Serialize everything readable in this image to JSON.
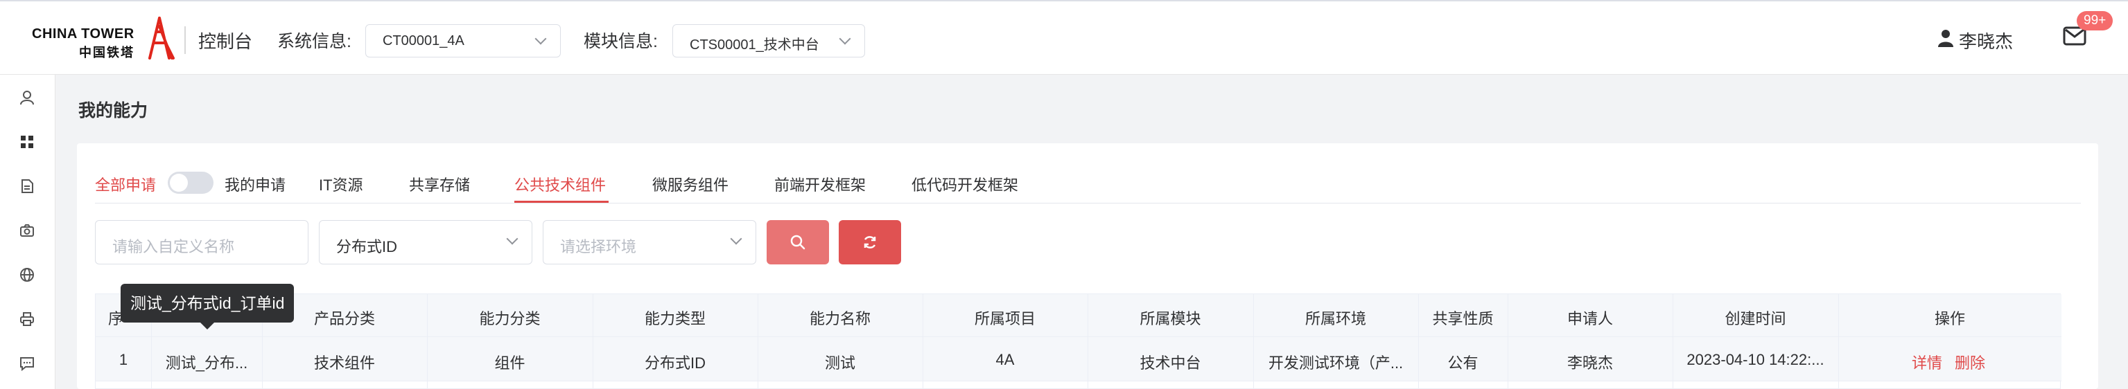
{
  "header": {
    "logo_en": "CHINA TOWER",
    "logo_cn": "中国铁塔",
    "console": "控制台",
    "system_label": "系统信息:",
    "system_value": "CT00001_4A",
    "module_label": "模块信息:",
    "module_value": "CTS00001_技术中台",
    "user_name": "李晓杰",
    "mail_badge": "99+"
  },
  "sidebar": {
    "items": [
      "user-icon",
      "grid-icon",
      "document-icon",
      "camera-icon",
      "globe-icon",
      "printer-icon",
      "chat-icon"
    ]
  },
  "page": {
    "title": "我的能力"
  },
  "tabs": {
    "all_label": "全部申请",
    "toggle_on": false,
    "mine_label": "我的申请",
    "items": [
      "IT资源",
      "共享存储",
      "公共技术组件",
      "微服务组件",
      "前端开发框架",
      "低代码开发框架"
    ],
    "active_index": 2
  },
  "filters": {
    "name_placeholder": "请输入自定义名称",
    "type_value": "分布式ID",
    "env_placeholder": "请选择环境"
  },
  "colors": {
    "accent": "#e04a4a",
    "search_button": "#e87474",
    "reset_button": "#e05252"
  },
  "table": {
    "columns": [
      "序",
      "",
      "产品分类",
      "能力分类",
      "能力类型",
      "能力名称",
      "所属项目",
      "所属模块",
      "所属环境",
      "共享性质",
      "申请人",
      "创建时间",
      "操作"
    ],
    "rows": [
      {
        "index": "1",
        "name": "测试_分布...",
        "product": "技术组件",
        "category": "组件",
        "type": "分布式ID",
        "ability_name": "测试",
        "project": "4A",
        "module": "技术中台",
        "env": "开发测试环境（产...",
        "share": "公有",
        "applicant": "李晓杰",
        "created": "2023-04-10 14:22:...",
        "actions": [
          "详情",
          "删除"
        ]
      }
    ]
  },
  "tooltip": {
    "text": "测试_分布式id_订单id"
  }
}
